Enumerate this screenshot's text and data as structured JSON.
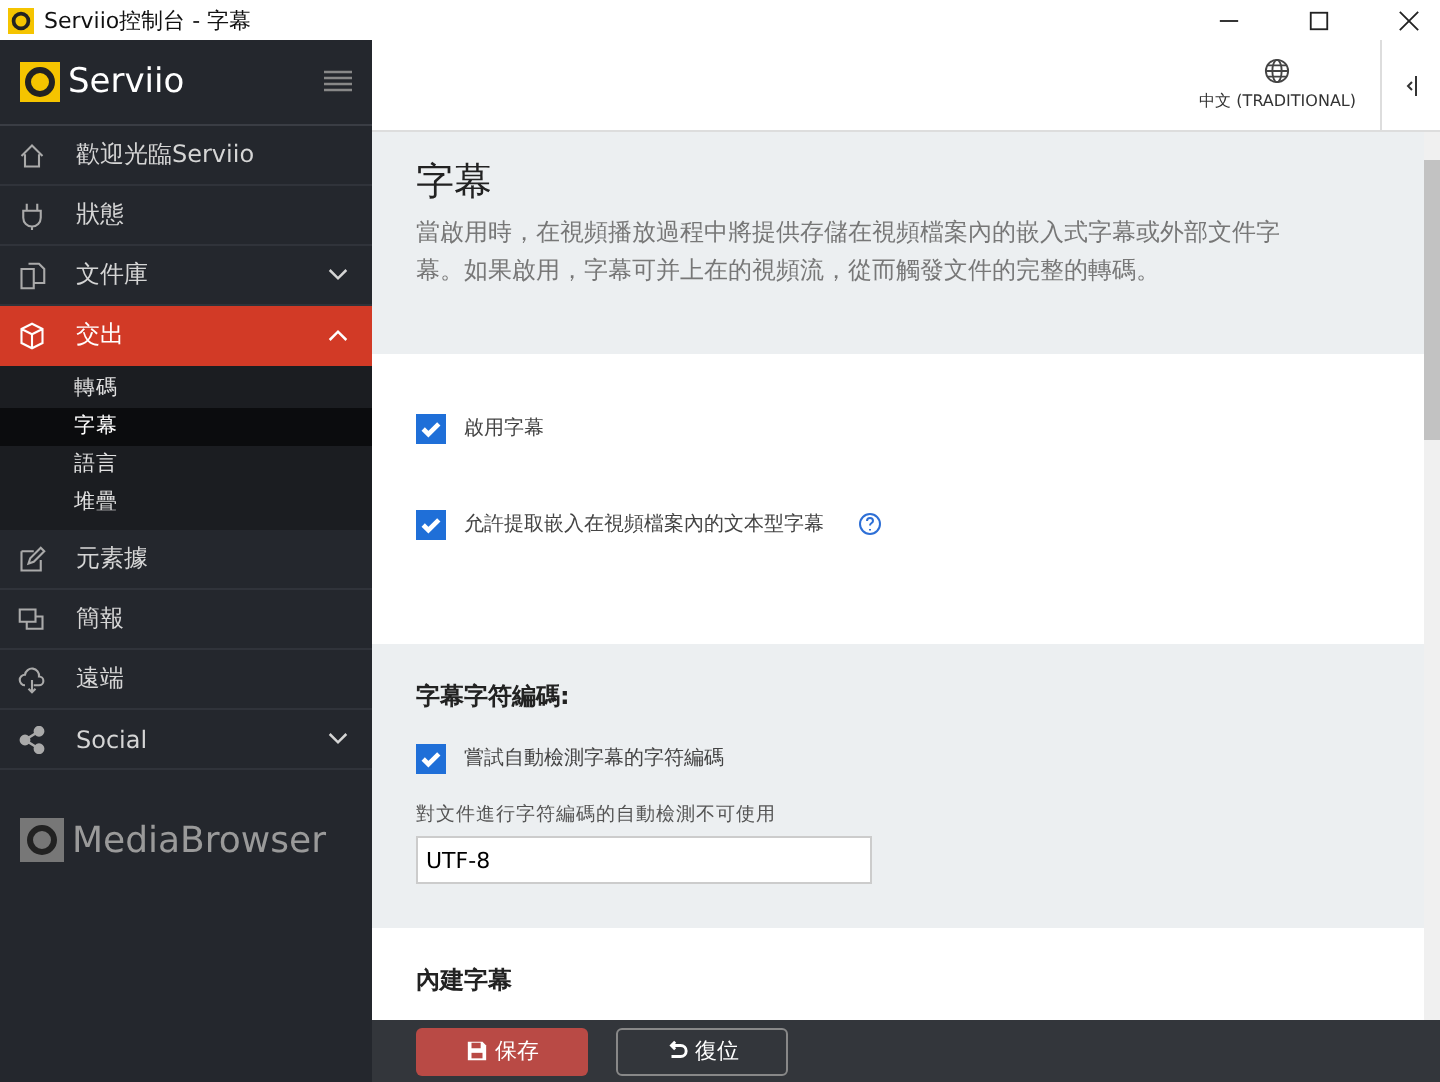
{
  "window": {
    "title": "Serviio控制台 - 字幕"
  },
  "sidebar": {
    "logo": "Serviio",
    "items": [
      {
        "label": "歡迎光臨Serviio",
        "selected": false
      },
      {
        "label": "狀態",
        "selected": false
      },
      {
        "label": "文件庫",
        "selected": false,
        "expanded": false
      },
      {
        "label": "交出",
        "selected": true,
        "expanded": true,
        "children": [
          {
            "label": "轉碼",
            "selected": false
          },
          {
            "label": "字幕",
            "selected": true
          },
          {
            "label": "語言",
            "selected": false
          },
          {
            "label": "堆疊",
            "selected": false
          }
        ]
      },
      {
        "label": "元素據",
        "selected": false
      },
      {
        "label": "簡報",
        "selected": false
      },
      {
        "label": "遠端",
        "selected": false
      },
      {
        "label": "Social",
        "selected": false,
        "expanded": false
      }
    ],
    "footer_logo": "MediaBrowser"
  },
  "topbar": {
    "language": "中文 (TRADITIONAL)"
  },
  "page": {
    "title": "字幕",
    "description": "當啟用時，在視頻播放過程中將提供存儲在視頻檔案內的嵌入式字幕或外部文件字幕。如果啟用，字幕可并上在的視頻流，從而觸發文件的完整的轉碼。"
  },
  "sections": [
    {
      "checkboxes": [
        {
          "label": "啟用字幕",
          "checked": true,
          "help": false
        },
        {
          "label": "允許提取嵌入在視頻檔案內的文本型字幕",
          "checked": true,
          "help": true
        }
      ]
    },
    {
      "heading": "字幕字符編碼:",
      "checkboxes": [
        {
          "label": "嘗試自動檢測字幕的字符編碼",
          "checked": true,
          "help": false
        }
      ],
      "field": {
        "label": "對文件進行字符編碼的自動檢測不可使用",
        "value": "UTF-8"
      }
    },
    {
      "heading": "內建字幕"
    }
  ],
  "buttons": [
    {
      "label": "保存",
      "kind": "primary"
    },
    {
      "label": "復位",
      "kind": "secondary"
    }
  ]
}
